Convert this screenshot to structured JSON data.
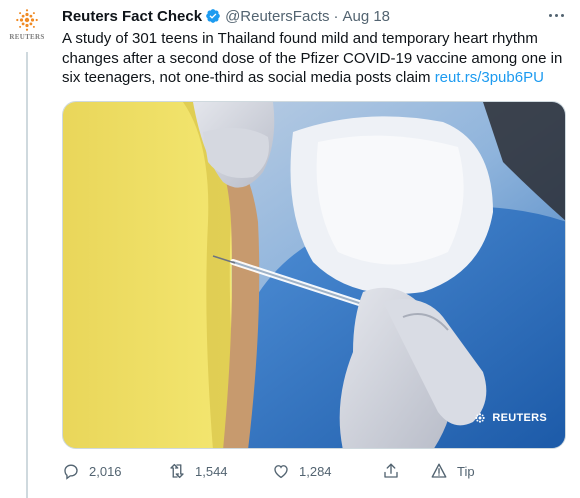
{
  "tweet": {
    "author_name": "Reuters Fact Check",
    "handle": "@ReutersFacts",
    "separator": "·",
    "date": "Aug 18",
    "text": "A study of 301 teens in Thailand found mild and temporary heart rhythm changes after a second dose of the Pfizer COVID-19 vaccine among one in six teenagers, not one-third as social media posts claim ",
    "link": "reut.rs/3pub6PU",
    "avatar_wordmark": "REUTERS",
    "media_watermark": "REUTERS",
    "icons": {
      "verified": "verified-badge-icon",
      "more": "more-options-icon",
      "reply": "reply-icon",
      "retweet": "retweet-icon",
      "like": "like-icon",
      "share": "share-icon",
      "tip": "tip-icon"
    },
    "colors": {
      "accent": "#1d9bf0",
      "muted": "#536471"
    }
  },
  "actions": {
    "reply_count": "2,016",
    "retweet_count": "1,544",
    "like_count": "1,284",
    "tip_label": "Tip"
  }
}
